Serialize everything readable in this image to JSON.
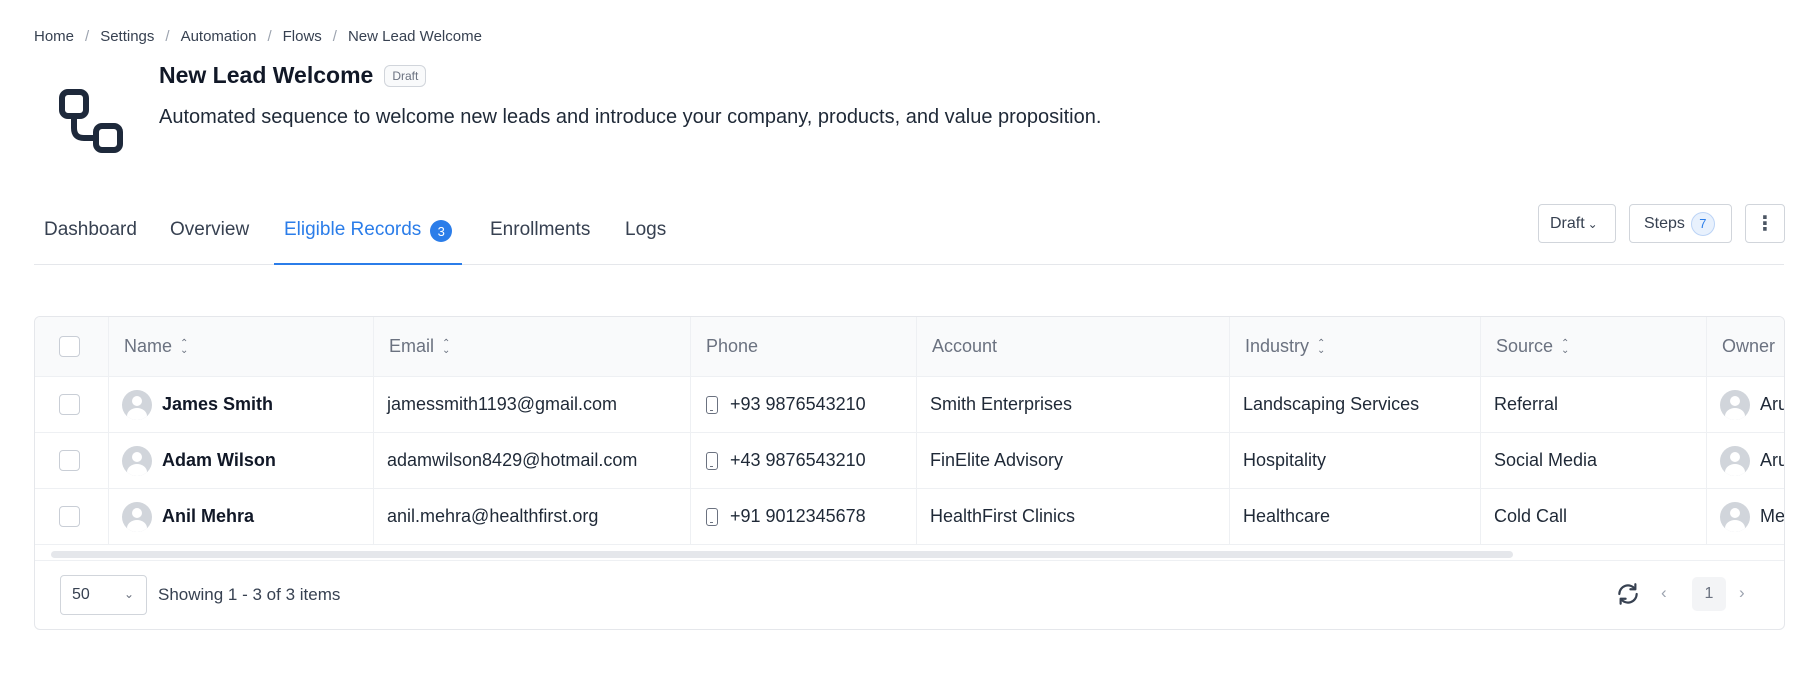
{
  "breadcrumb": [
    "Home",
    "Settings",
    "Automation",
    "Flows",
    "New Lead Welcome"
  ],
  "flow": {
    "icon": "workflow-icon",
    "title": "New Lead Welcome",
    "status_badge": "Draft",
    "description": "Automated sequence to welcome new leads and introduce your company, products, and value proposition."
  },
  "tabs": [
    {
      "label": "Dashboard"
    },
    {
      "label": "Overview"
    },
    {
      "label": "Eligible Records",
      "count": "3",
      "active": true
    },
    {
      "label": "Enrollments"
    },
    {
      "label": "Logs"
    }
  ],
  "header_actions": {
    "status_select": "Draft",
    "steps_label": "Steps",
    "steps_count": "7",
    "more_icon": "vertical-dots-icon"
  },
  "table": {
    "columns": [
      "Name",
      "Email",
      "Phone",
      "Account",
      "Industry",
      "Source",
      "Owner"
    ],
    "rows": [
      {
        "name": "James Smith",
        "email": "jamessmith1193@gmail.com",
        "phone": "+93 9876543210",
        "account": "Smith Enterprises",
        "industry": "Landscaping Services",
        "source": "Referral",
        "owner": "Aru"
      },
      {
        "name": "Adam Wilson",
        "email": "adamwilson8429@hotmail.com",
        "phone": "+43 9876543210",
        "account": "FinElite Advisory",
        "industry": "Hospitality",
        "source": "Social Media",
        "owner": "Aru"
      },
      {
        "name": "Anil Mehra",
        "email": "anil.mehra@healthfirst.org",
        "phone": "+91 9012345678",
        "account": "HealthFirst Clinics",
        "industry": "Healthcare",
        "source": "Cold Call",
        "owner": "Me"
      }
    ]
  },
  "pagination": {
    "page_size": "50",
    "summary": "Showing 1 - 3 of 3 items",
    "current_page": "1"
  },
  "colors": {
    "accent": "#2b7de9",
    "text": "#1f2937",
    "muted": "#6b7280",
    "border": "#e5e7eb"
  }
}
